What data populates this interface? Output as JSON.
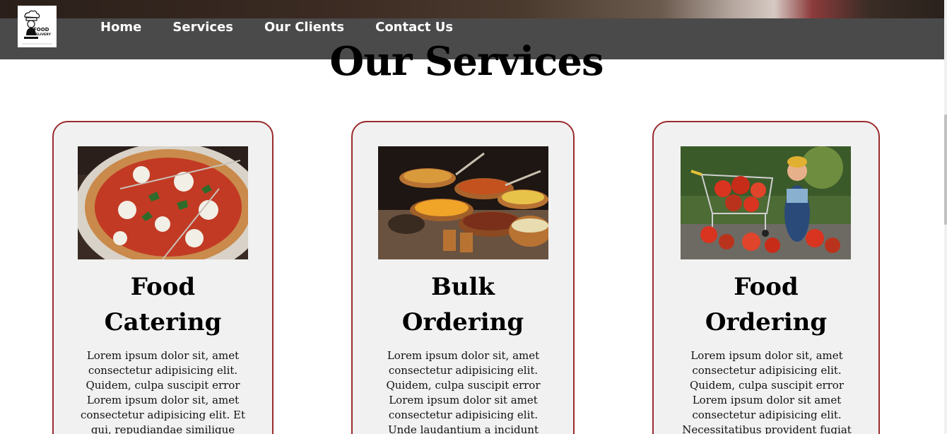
{
  "brand": {
    "logo_text_line1": "FOOD",
    "logo_text_line2": "DELIVERY",
    "logo_icon": "chef-icon"
  },
  "nav": {
    "items": [
      {
        "label": "Home"
      },
      {
        "label": "Services"
      },
      {
        "label": "Our Clients"
      },
      {
        "label": "Contact Us"
      }
    ]
  },
  "services": {
    "title": "Our Services",
    "cards": [
      {
        "title_line1": "Food",
        "title_line2": "Catering",
        "image": "pizza-image",
        "text": "Lorem ipsum dolor sit, amet consectetur adipisicing elit. Quidem, culpa suscipit error Lorem ipsum dolor sit, amet consectetur adipisicing elit. Et qui, repudiandae similique nam,"
      },
      {
        "title_line1": "Bulk",
        "title_line2": "Ordering",
        "image": "buffet-image",
        "text": "Lorem ipsum dolor sit, amet consectetur adipisicing elit. Quidem, culpa suscipit error Lorem ipsum dolor sit amet consectetur adipisicing elit. Unde laudantium a incidunt animi ad,"
      },
      {
        "title_line1": "Food",
        "title_line2": "Ordering",
        "image": "shopping-cart-image",
        "text": "Lorem ipsum dolor sit, amet consectetur adipisicing elit. Quidem, culpa suscipit error Lorem ipsum dolor sit amet consectetur adipisicing elit. Necessitatibus provident fugiat"
      }
    ]
  },
  "colors": {
    "card_border": "#9b2b2e",
    "card_bg": "#f1f1f1",
    "navbar_bg": "#4a4a4a"
  }
}
